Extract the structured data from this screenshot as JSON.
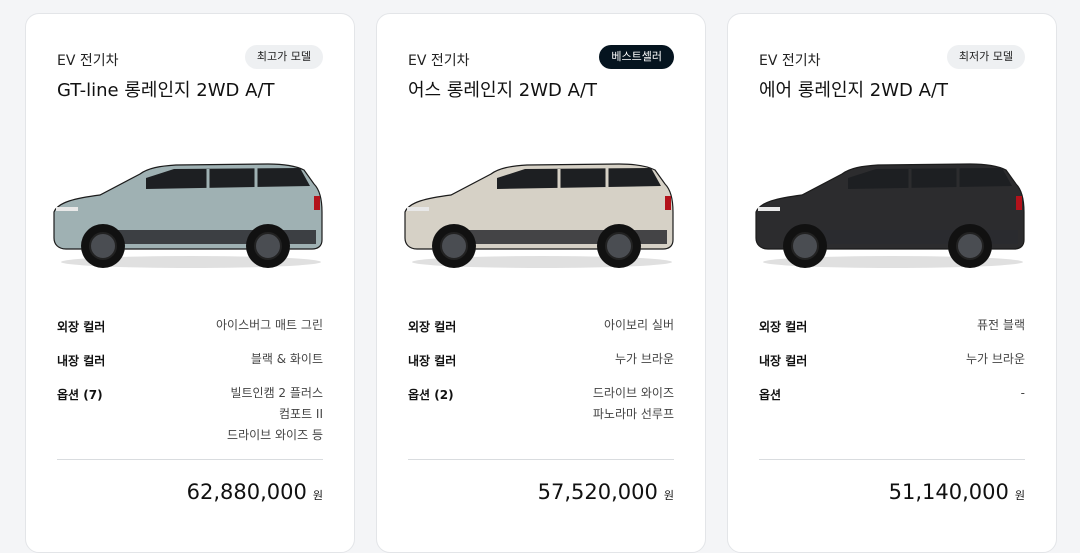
{
  "cards": [
    {
      "type": "EV 전기차",
      "badge": "최고가 모델",
      "badge_style": "light",
      "model": "GT-line 롱레인지 2WD A/T",
      "car_color": "#9fb1b3",
      "ext_label": "외장 컬러",
      "ext_value": "아이스버그 매트 그린",
      "int_label": "내장 컬러",
      "int_value": "블랙 & 화이트",
      "opt_label": "옵션 (7)",
      "opt_values": [
        "빌트인캠 2 플러스",
        "컴포트 II",
        "드라이브 와이즈 등"
      ],
      "price": "62,880,000",
      "currency": "원"
    },
    {
      "type": "EV 전기차",
      "badge": "베스트셀러",
      "badge_style": "dark",
      "model": "어스 롱레인지 2WD A/T",
      "car_color": "#d6d1c6",
      "ext_label": "외장 컬러",
      "ext_value": "아이보리 실버",
      "int_label": "내장 컬러",
      "int_value": "누가 브라운",
      "opt_label": "옵션 (2)",
      "opt_values": [
        "드라이브 와이즈",
        "파노라마 선루프"
      ],
      "price": "57,520,000",
      "currency": "원"
    },
    {
      "type": "EV 전기차",
      "badge": "최저가 모델",
      "badge_style": "light",
      "model": "에어 롱레인지 2WD A/T",
      "car_color": "#2c2c2e",
      "ext_label": "외장 컬러",
      "ext_value": "퓨전 블랙",
      "int_label": "내장 컬러",
      "int_value": "누가 브라운",
      "opt_label": "옵션",
      "opt_values": [
        "-"
      ],
      "price": "51,140,000",
      "currency": "원"
    }
  ]
}
